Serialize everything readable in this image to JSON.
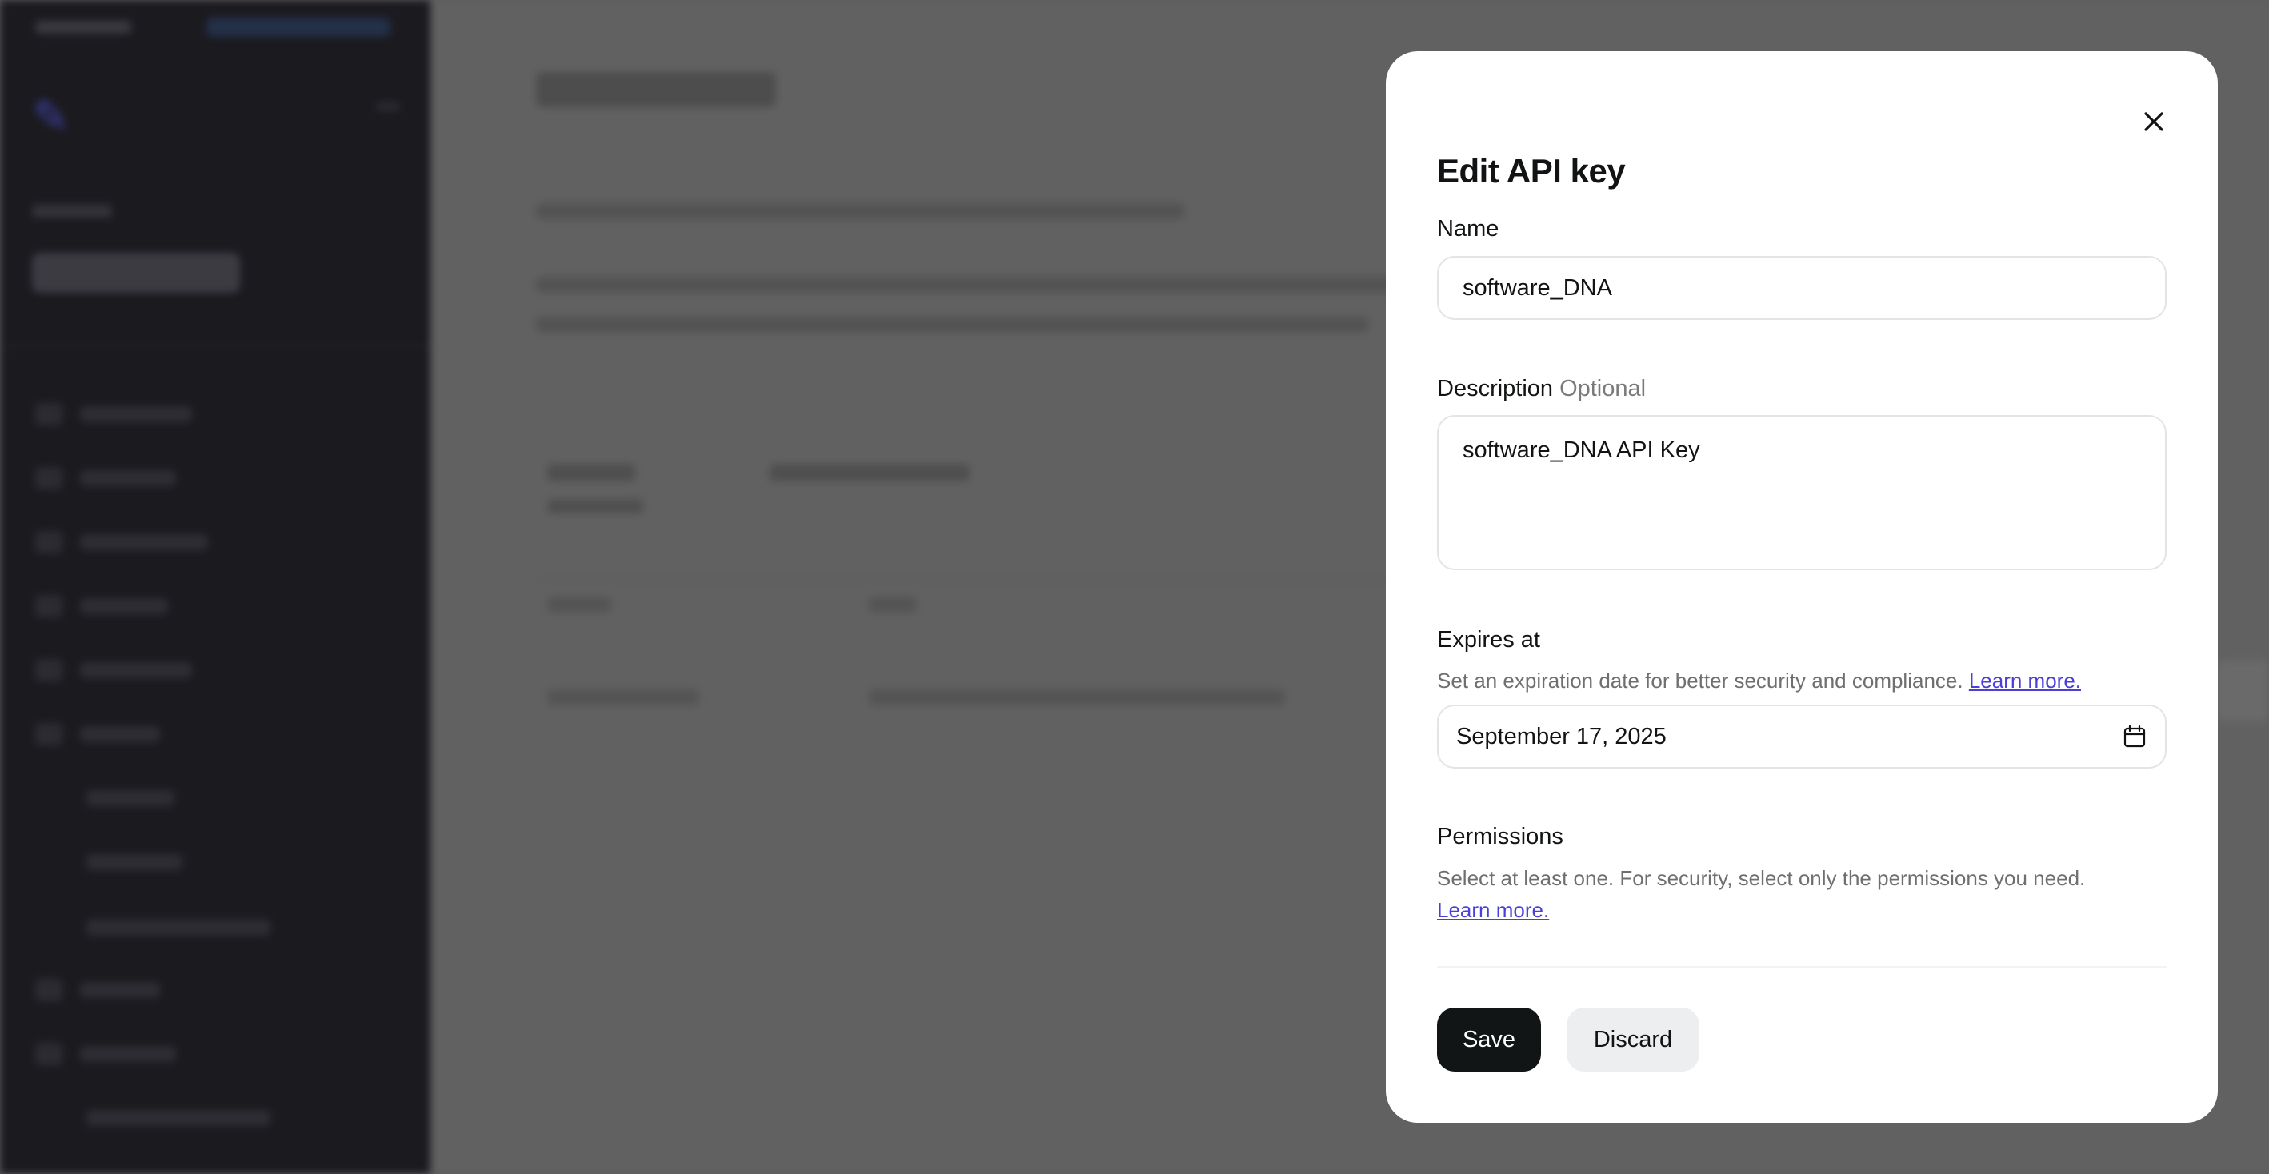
{
  "modal": {
    "title": "Edit API key",
    "name": {
      "label": "Name",
      "value": "software_DNA"
    },
    "description": {
      "label": "Description",
      "optional_tag": "Optional",
      "value": "software_DNA API Key"
    },
    "expires": {
      "label": "Expires at",
      "helper": "Set an expiration date for better security and compliance.",
      "learn_more": "Learn more.",
      "date": "September 17, 2025"
    },
    "permissions": {
      "label": "Permissions",
      "helper": "Select at least one. For security, select only the permissions you need.",
      "learn_more": "Learn more."
    },
    "buttons": {
      "save": "Save",
      "discard": "Discard"
    }
  },
  "icons": {
    "close": "close-icon",
    "calendar": "calendar-icon"
  },
  "colors": {
    "overlay": "#5e5e5e",
    "sidebar": "#1b1a1f",
    "link": "#4a3fd6",
    "primary_button": "#121516",
    "secondary_button": "#eceef0"
  }
}
